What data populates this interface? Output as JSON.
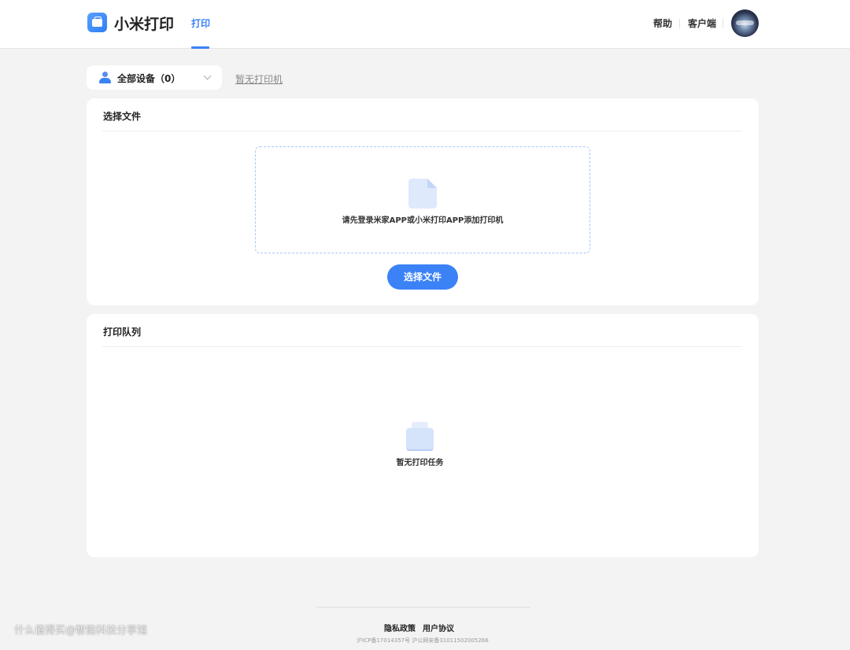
{
  "header": {
    "app_title": "小米打印",
    "nav_tab": "打印",
    "help": "帮助",
    "client": "客户端",
    "accent_color": "#3b82f6"
  },
  "toolbar": {
    "device_select_label": "全部设备（0）",
    "no_printer": "暂无打印机"
  },
  "select_file_card": {
    "title": "选择文件",
    "dropzone_hint": "请先登录米家APP或小米打印APP添加打印机",
    "button_label": "选择文件"
  },
  "queue_card": {
    "title": "打印队列",
    "empty_text": "暂无打印任务"
  },
  "footer": {
    "privacy": "隐私政策",
    "terms": "用户协议",
    "icp": "沪ICP备17014357号 沪公网安备31011502005266"
  },
  "watermark": "什么值得买@智能科技分享馆",
  "icons": {
    "logo": "printer-logo-icon",
    "user": "user-icon",
    "dropdown": "chevron-down-icon",
    "file": "file-icon",
    "printer": "printer-icon"
  }
}
